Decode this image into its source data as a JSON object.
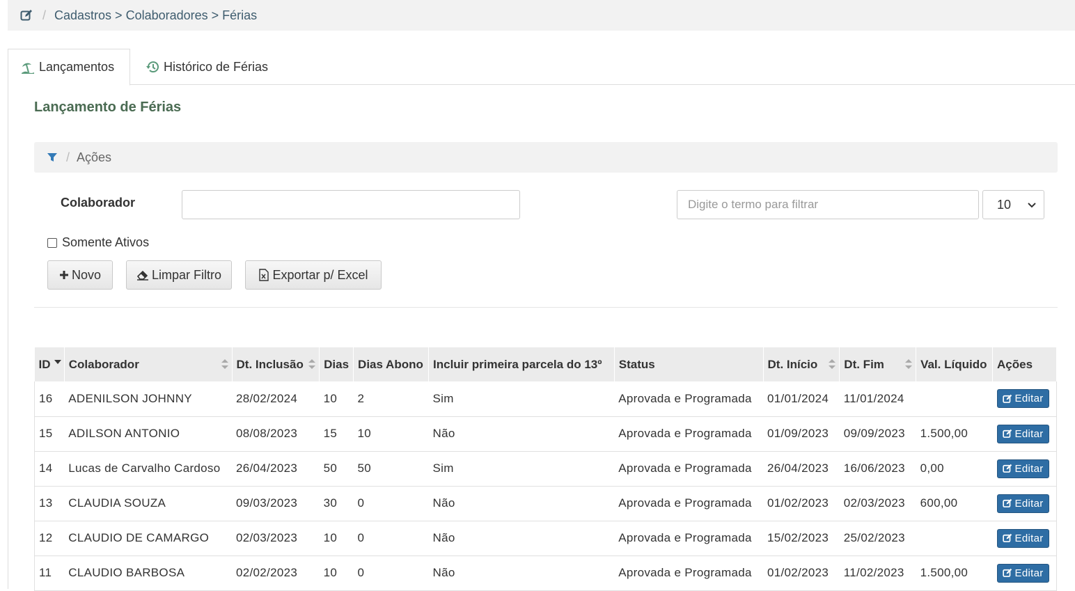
{
  "breadcrumb": {
    "path": "Cadastros > Colaboradores > Férias",
    "separator": "/"
  },
  "tabs": [
    {
      "label": "Lançamentos",
      "icon": "beach-icon",
      "active": true
    },
    {
      "label": "Histórico de Férias",
      "icon": "history-icon",
      "active": false
    }
  ],
  "section_title": "Lançamento de Férias",
  "filter_bar": {
    "label": "Ações",
    "separator": "/"
  },
  "form": {
    "colaborador_label": "Colaborador",
    "colaborador_value": "",
    "filter_placeholder": "Digite o termo para filtrar",
    "page_size": "10",
    "somente_ativos_label": "Somente Ativos",
    "somente_ativos_checked": false
  },
  "buttons": {
    "novo": "Novo",
    "limpar": "Limpar Filtro",
    "exportar": "Exportar p/ Excel"
  },
  "table": {
    "columns": [
      "ID",
      "Colaborador",
      "Dt. Inclusão",
      "Dias",
      "Dias Abono",
      "Incluir primeira parcela do 13º",
      "Status",
      "Dt. Início",
      "Dt. Fim",
      "Val. Líquido",
      "Ações"
    ],
    "edit_label": "Editar",
    "rows": [
      {
        "id": "16",
        "colaborador": "ADENILSON JOHNNY",
        "inclusao": "28/02/2024",
        "dias": "10",
        "abono": "2",
        "parcela": "Sim",
        "status": "Aprovada e Programada",
        "inicio": "01/01/2024",
        "fim": "11/01/2024",
        "valor": ""
      },
      {
        "id": "15",
        "colaborador": "ADILSON ANTONIO",
        "inclusao": "08/08/2023",
        "dias": "15",
        "abono": "10",
        "parcela": "Não",
        "status": "Aprovada e Programada",
        "inicio": "01/09/2023",
        "fim": "09/09/2023",
        "valor": "1.500,00"
      },
      {
        "id": "14",
        "colaborador": "Lucas de Carvalho Cardoso",
        "inclusao": "26/04/2023",
        "dias": "50",
        "abono": "50",
        "parcela": "Sim",
        "status": "Aprovada e Programada",
        "inicio": "26/04/2023",
        "fim": "16/06/2023",
        "valor": "0,00"
      },
      {
        "id": "13",
        "colaborador": "CLAUDIA SOUZA",
        "inclusao": "09/03/2023",
        "dias": "30",
        "abono": "0",
        "parcela": "Não",
        "status": "Aprovada e Programada",
        "inicio": "01/02/2023",
        "fim": "02/03/2023",
        "valor": "600,00"
      },
      {
        "id": "12",
        "colaborador": "CLAUDIO DE CAMARGO",
        "inclusao": "02/03/2023",
        "dias": "10",
        "abono": "0",
        "parcela": "Não",
        "status": "Aprovada e Programada",
        "inicio": "15/02/2023",
        "fim": "25/02/2023",
        "valor": ""
      },
      {
        "id": "11",
        "colaborador": "CLAUDIO BARBOSA",
        "inclusao": "02/02/2023",
        "dias": "10",
        "abono": "0",
        "parcela": "Não",
        "status": "Aprovada e Programada",
        "inicio": "01/02/2023",
        "fim": "11/02/2023",
        "valor": "1.500,00"
      }
    ]
  },
  "colors": {
    "accent": "#2e6da4",
    "breadcrumb_text": "#3e5c6e",
    "title_green": "#4a6b52",
    "filter_icon": "#337ab7"
  }
}
